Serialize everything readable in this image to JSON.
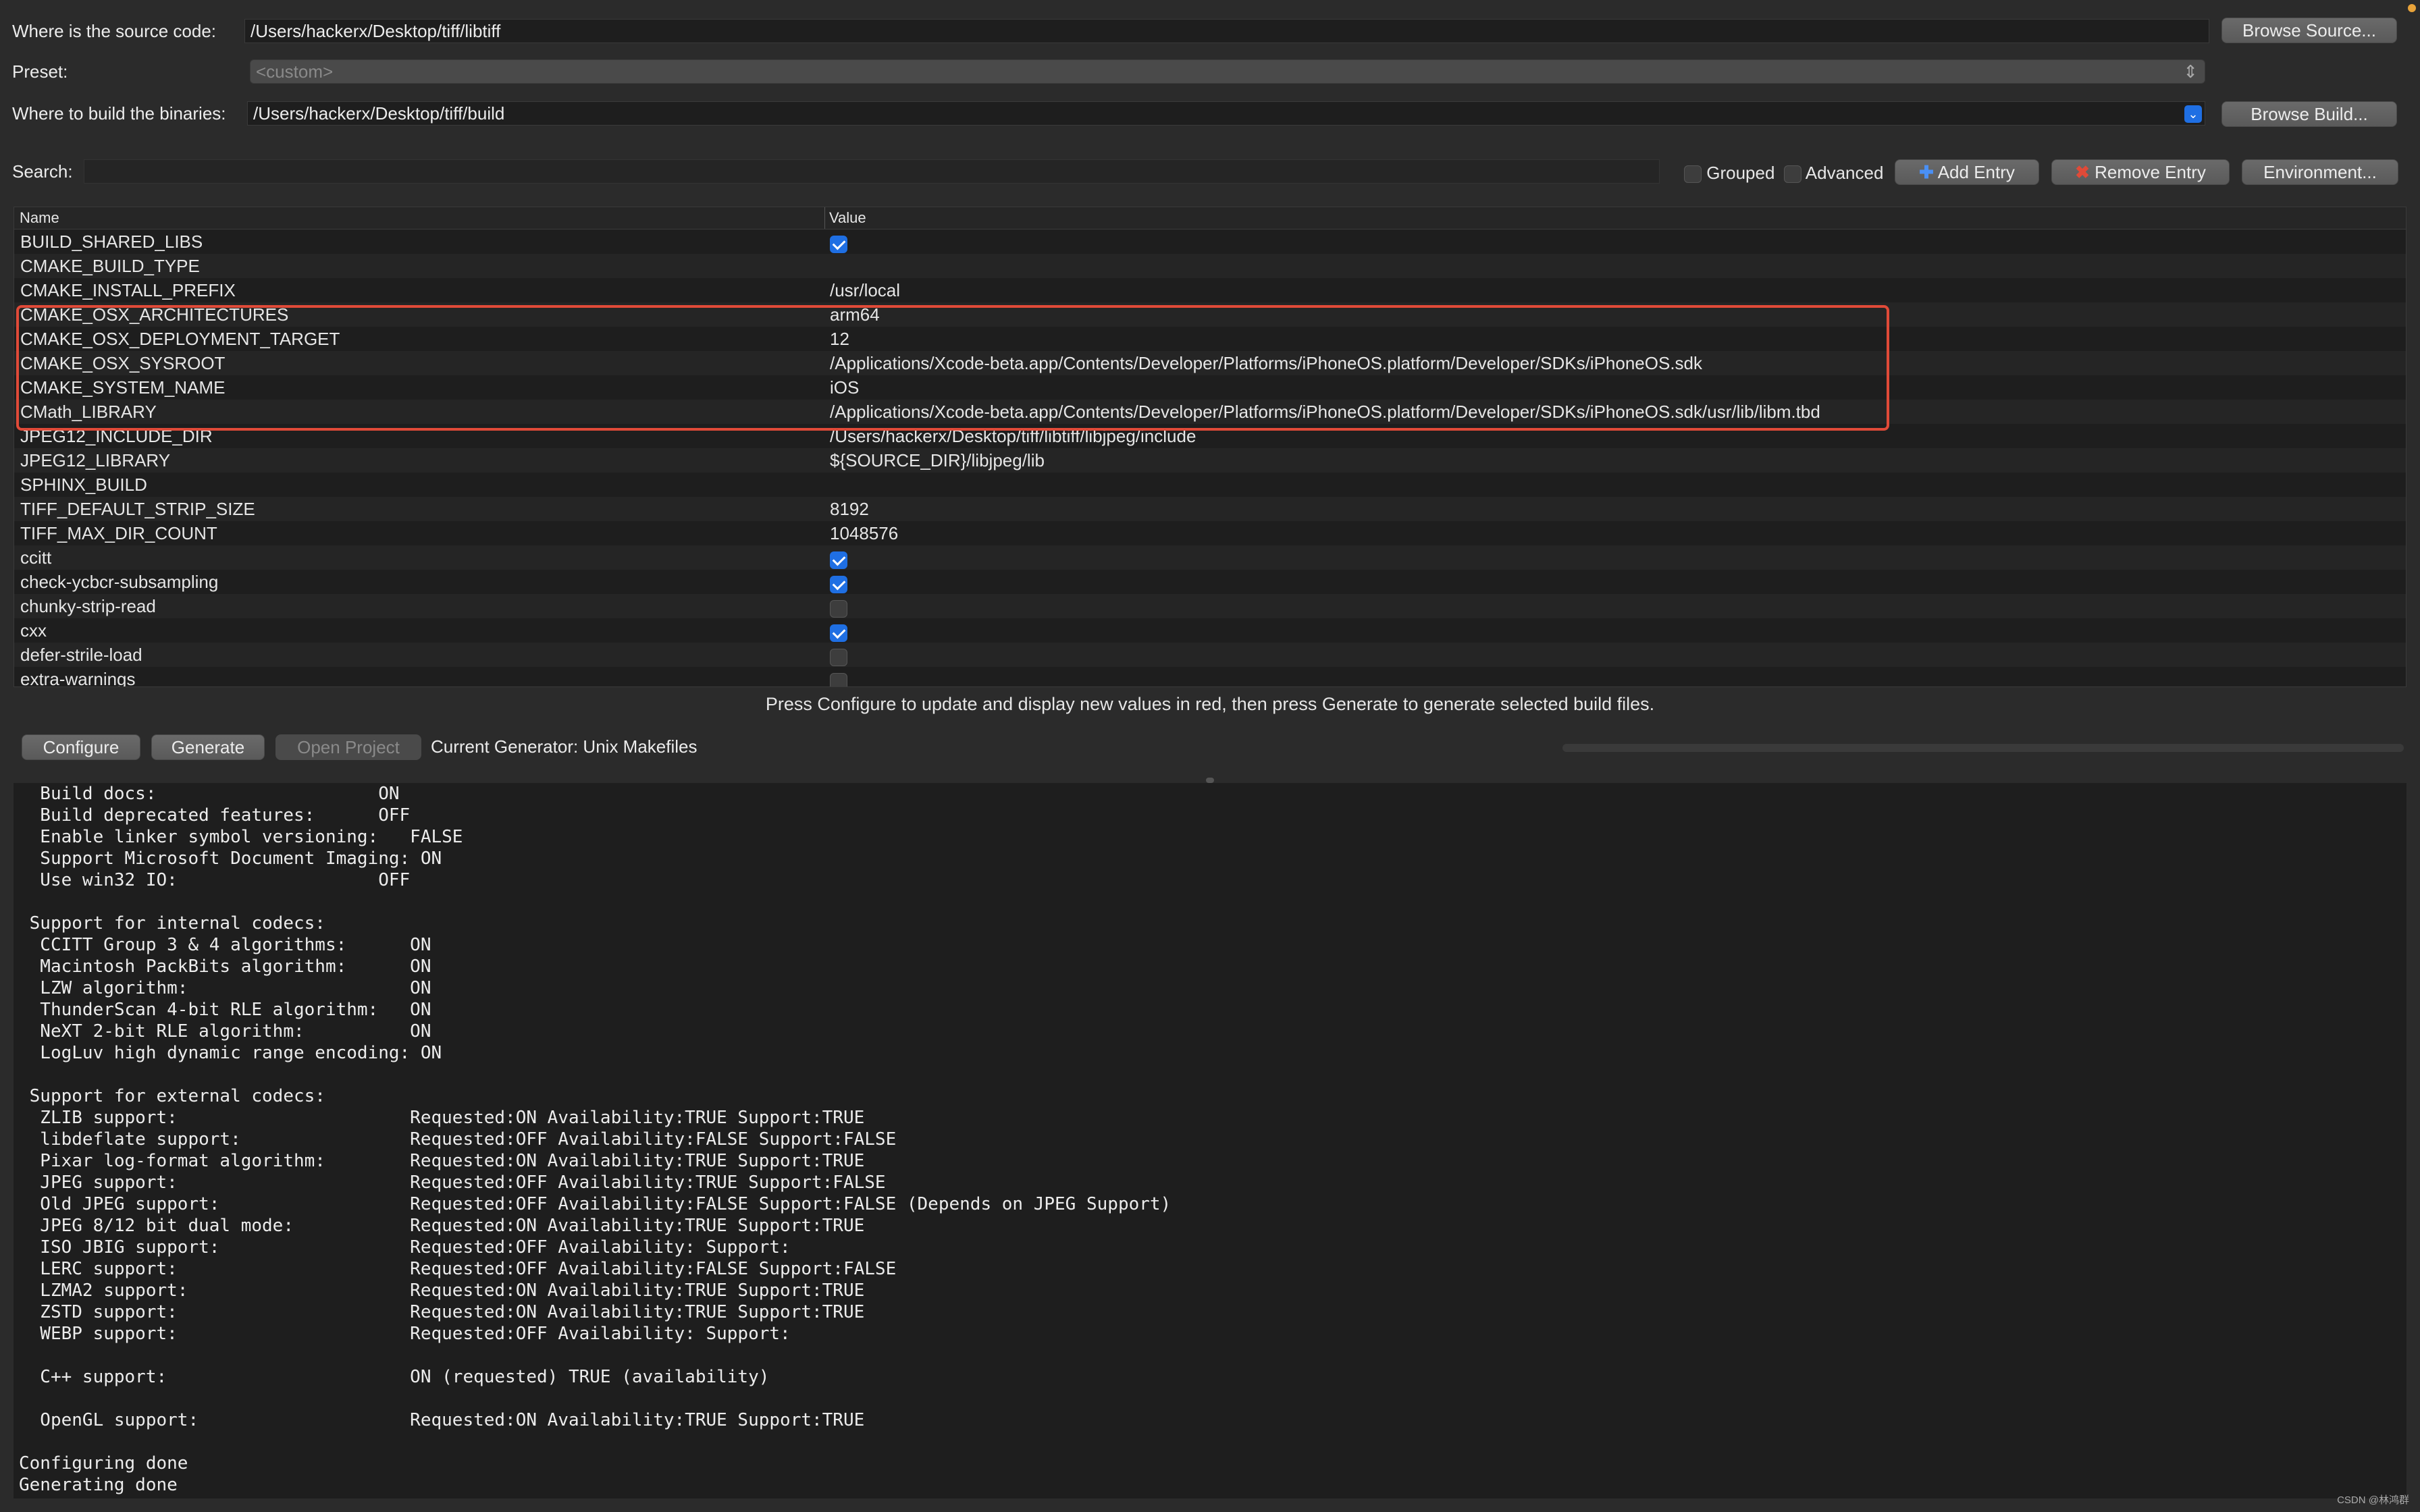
{
  "source": {
    "label": "Where is the source code:",
    "value": "/Users/hackerx/Desktop/tiff/libtiff",
    "browse": "Browse Source..."
  },
  "preset": {
    "label": "Preset:",
    "value": "<custom>"
  },
  "build": {
    "label": "Where to build the binaries:",
    "value": "/Users/hackerx/Desktop/tiff/build",
    "browse": "Browse Build..."
  },
  "search": {
    "label": "Search:",
    "value": ""
  },
  "toolbar": {
    "grouped": "Grouped",
    "advanced": "Advanced",
    "add_entry": "Add Entry",
    "remove_entry": "Remove Entry",
    "environment": "Environment..."
  },
  "table": {
    "col_name": "Name",
    "col_value": "Value",
    "rows": [
      {
        "name": "BUILD_SHARED_LIBS",
        "check": true
      },
      {
        "name": "CMAKE_BUILD_TYPE",
        "value": ""
      },
      {
        "name": "CMAKE_INSTALL_PREFIX",
        "value": "/usr/local"
      },
      {
        "name": "CMAKE_OSX_ARCHITECTURES",
        "value": "arm64"
      },
      {
        "name": "CMAKE_OSX_DEPLOYMENT_TARGET",
        "value": "12"
      },
      {
        "name": "CMAKE_OSX_SYSROOT",
        "value": "/Applications/Xcode-beta.app/Contents/Developer/Platforms/iPhoneOS.platform/Developer/SDKs/iPhoneOS.sdk"
      },
      {
        "name": "CMAKE_SYSTEM_NAME",
        "value": "iOS"
      },
      {
        "name": "CMath_LIBRARY",
        "value": "/Applications/Xcode-beta.app/Contents/Developer/Platforms/iPhoneOS.platform/Developer/SDKs/iPhoneOS.sdk/usr/lib/libm.tbd"
      },
      {
        "name": "JPEG12_INCLUDE_DIR",
        "value": "/Users/hackerx/Desktop/tiff/libtiff/libjpeg/include"
      },
      {
        "name": "JPEG12_LIBRARY",
        "value": "${SOURCE_DIR}/libjpeg/lib"
      },
      {
        "name": "SPHINX_BUILD",
        "value": ""
      },
      {
        "name": "TIFF_DEFAULT_STRIP_SIZE",
        "value": "8192"
      },
      {
        "name": "TIFF_MAX_DIR_COUNT",
        "value": "1048576"
      },
      {
        "name": "ccitt",
        "check": true
      },
      {
        "name": "check-ycbcr-subsampling",
        "check": true
      },
      {
        "name": "chunky-strip-read",
        "check": false
      },
      {
        "name": "cxx",
        "check": true
      },
      {
        "name": "defer-strile-load",
        "check": false
      },
      {
        "name": "extra-warnings",
        "check": false
      }
    ]
  },
  "status_message": "Press Configure to update and display new values in red, then press Generate to generate selected build files.",
  "actions": {
    "configure": "Configure",
    "generate": "Generate",
    "open_project": "Open Project",
    "generator": "Current Generator: Unix Makefiles"
  },
  "console": [
    "  Build docs:                     ON",
    "  Build deprecated features:      OFF",
    "  Enable linker symbol versioning:   FALSE",
    "  Support Microsoft Document Imaging: ON",
    "  Use win32 IO:                   OFF",
    "",
    " Support for internal codecs:",
    "  CCITT Group 3 & 4 algorithms:      ON",
    "  Macintosh PackBits algorithm:      ON",
    "  LZW algorithm:                     ON",
    "  ThunderScan 4-bit RLE algorithm:   ON",
    "  NeXT 2-bit RLE algorithm:          ON",
    "  LogLuv high dynamic range encoding: ON",
    "",
    " Support for external codecs:",
    "  ZLIB support:                      Requested:ON Availability:TRUE Support:TRUE",
    "  libdeflate support:                Requested:OFF Availability:FALSE Support:FALSE",
    "  Pixar log-format algorithm:        Requested:ON Availability:TRUE Support:TRUE",
    "  JPEG support:                      Requested:OFF Availability:TRUE Support:FALSE",
    "  Old JPEG support:                  Requested:OFF Availability:FALSE Support:FALSE (Depends on JPEG Support)",
    "  JPEG 8/12 bit dual mode:           Requested:ON Availability:TRUE Support:TRUE",
    "  ISO JBIG support:                  Requested:OFF Availability: Support:",
    "  LERC support:                      Requested:OFF Availability:FALSE Support:FALSE",
    "  LZMA2 support:                     Requested:ON Availability:TRUE Support:TRUE",
    "  ZSTD support:                      Requested:ON Availability:TRUE Support:TRUE",
    "  WEBP support:                      Requested:OFF Availability: Support:",
    "",
    "  C++ support:                       ON (requested) TRUE (availability)",
    "",
    "  OpenGL support:                    Requested:ON Availability:TRUE Support:TRUE",
    "",
    "Configuring done",
    "Generating done"
  ],
  "watermark": "CSDN @林鸿群"
}
